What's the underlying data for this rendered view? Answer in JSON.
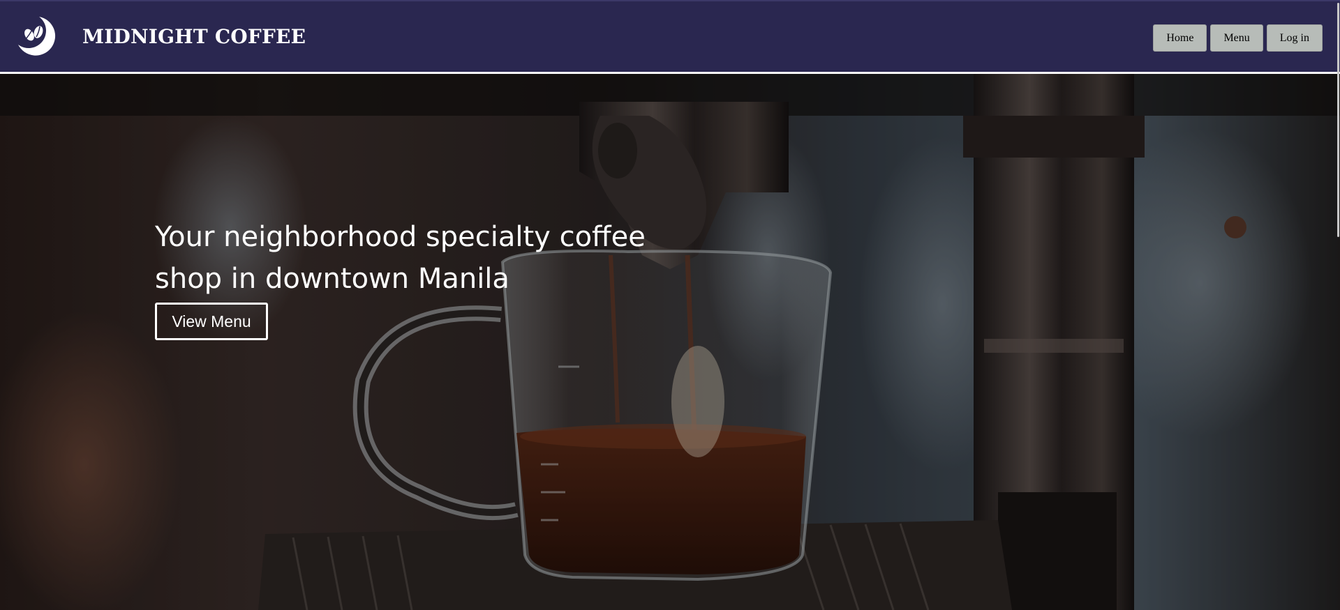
{
  "brand": {
    "name": "MIDNIGHT COFFEE",
    "logo_icon": "moon-coffee-bean-icon"
  },
  "nav": {
    "items": [
      {
        "label": "Home"
      },
      {
        "label": "Menu"
      },
      {
        "label": "Log in"
      }
    ]
  },
  "hero": {
    "heading": "Your neighborhood specialty coffee shop in downtown Manila",
    "cta_label": "View Menu",
    "image": "espresso-machine-pouring-into-glass-mug"
  },
  "colors": {
    "navbar": "#2a2750",
    "nav_button": "#b7bcb8",
    "text_light": "#ffffff"
  }
}
